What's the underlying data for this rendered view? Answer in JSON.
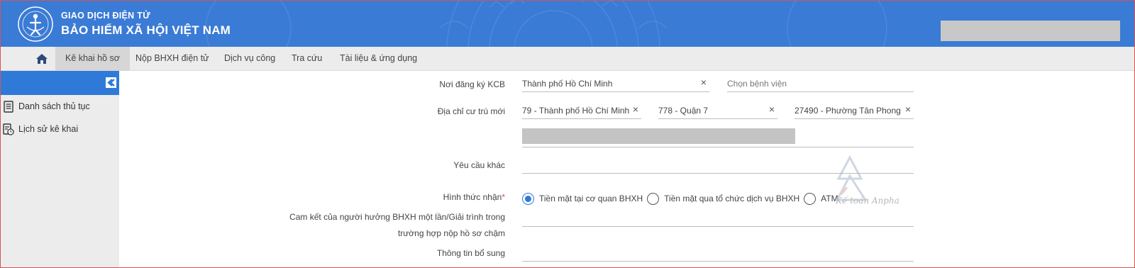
{
  "header": {
    "org_top": "GIAO DỊCH ĐIỆN TỬ",
    "org_main": "BẢO HIỂM XÃ HỘI VIỆT NAM",
    "logo_icon": "bhxh-logo-icon"
  },
  "nav": {
    "home_icon": "home-icon",
    "items": [
      {
        "label": "Kê khai hồ sơ",
        "active": true
      },
      {
        "label": "Nộp BHXH điện tử",
        "active": false
      },
      {
        "label": "Dịch vụ công",
        "active": false
      },
      {
        "label": "Tra cứu",
        "active": false
      },
      {
        "label": "Tài liệu & ứng dụng",
        "active": false
      }
    ]
  },
  "sidebar": {
    "collapse_icon": "collapse-left-icon",
    "items": [
      {
        "label": "Danh sách thủ tục",
        "icon": "document-list-icon"
      },
      {
        "label": "Lịch sử kê khai",
        "icon": "history-icon"
      }
    ]
  },
  "form": {
    "kcb": {
      "label": "Nơi đăng ký KCB",
      "city_value": "Thành phố Hồ Chí Minh",
      "hospital_placeholder": "Chọn bệnh viện"
    },
    "address": {
      "label": "Địa chỉ cư trú mới",
      "province": "79 - Thành phố Hồ Chí Minh",
      "district": "778 - Quận 7",
      "ward": "27490 - Phường Tân Phong"
    },
    "other_request": {
      "label": "Yêu cầu khác",
      "value": ""
    },
    "receive_method": {
      "label": "Hình thức nhận",
      "required_mark": "*",
      "options": [
        {
          "label": "Tiền mặt tại cơ quan BHXH",
          "checked": true
        },
        {
          "label": "Tiền mặt qua tổ chức dịch vụ BHXH",
          "checked": false
        },
        {
          "label": "ATM",
          "checked": false
        }
      ]
    },
    "commitment": {
      "label_line1": "Cam kết của người hưởng BHXH một lần/Giải trình trong",
      "label_line2": "trường hợp nộp hồ sơ chậm",
      "value": ""
    },
    "additional_info": {
      "label": "Thông tin bổ sung",
      "value": ""
    }
  },
  "watermark": {
    "text": "Kế toán Anpha"
  },
  "colors": {
    "header_bg": "#3a7bd5",
    "accent": "#2f7ad8",
    "nav_bg": "#ececec"
  }
}
